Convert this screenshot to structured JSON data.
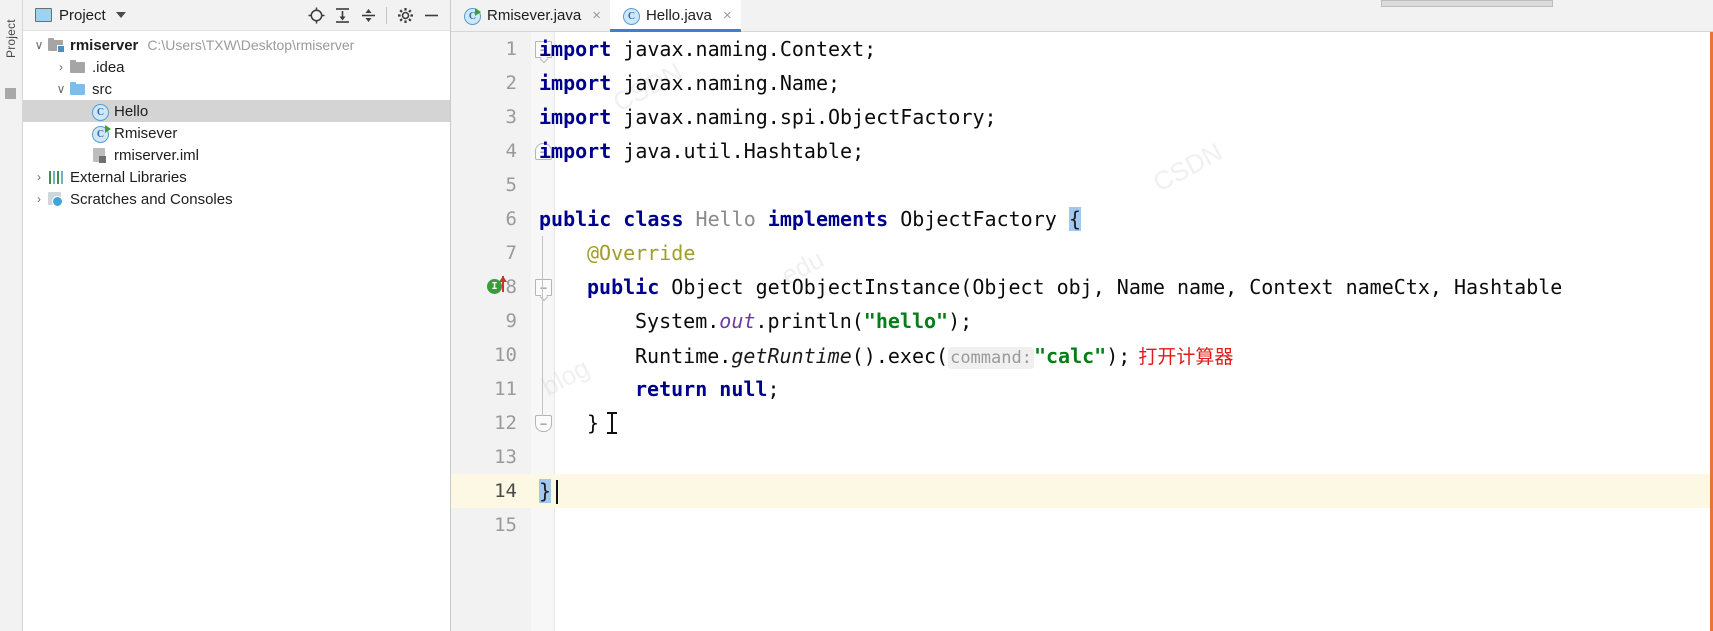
{
  "toolwindow": {
    "vertical_label": "Project"
  },
  "project_panel": {
    "header": {
      "title": "Project",
      "dropdown_icon": "chevron-down-icon",
      "actions": [
        {
          "name": "locate-icon",
          "glyph": "⊕"
        },
        {
          "name": "expand-all-icon",
          "glyph": "⤓"
        },
        {
          "name": "collapse-all-icon",
          "glyph": "⤒"
        },
        {
          "name": "settings-gear-icon",
          "glyph": "⚙"
        },
        {
          "name": "hide-icon",
          "glyph": "—"
        }
      ]
    },
    "tree": [
      {
        "label": "rmiserver",
        "path": "C:\\Users\\TXW\\Desktop\\rmiserver",
        "icon": "module-folder-icon",
        "arrow": "∨",
        "indent": 0,
        "bold": true,
        "selected": false
      },
      {
        "label": ".idea",
        "path": "",
        "icon": "folder-gray-icon",
        "arrow": "›",
        "indent": 1,
        "bold": false,
        "selected": false
      },
      {
        "label": "src",
        "path": "",
        "icon": "folder-blue-icon",
        "arrow": "∨",
        "indent": 1,
        "bold": false,
        "selected": false
      },
      {
        "label": "Hello",
        "path": "",
        "icon": "java-class-icon",
        "arrow": "",
        "indent": 2,
        "bold": false,
        "selected": true
      },
      {
        "label": "Rmisever",
        "path": "",
        "icon": "java-runnable-class-icon",
        "arrow": "",
        "indent": 2,
        "bold": false,
        "selected": false
      },
      {
        "label": "rmiserver.iml",
        "path": "",
        "icon": "iml-file-icon",
        "arrow": "",
        "indent": 1,
        "bold": false,
        "selected": false
      },
      {
        "label": "External Libraries",
        "path": "",
        "icon": "libraries-icon",
        "arrow": "›",
        "indent": 0,
        "bold": false,
        "selected": false
      },
      {
        "label": "Scratches and Consoles",
        "path": "",
        "icon": "scratches-icon",
        "arrow": "›",
        "indent": 0,
        "bold": false,
        "selected": false
      }
    ]
  },
  "editor": {
    "tabs": [
      {
        "label": "Rmisever.java",
        "icon": "java-runnable-class-icon",
        "close": "×",
        "active": false
      },
      {
        "label": "Hello.java",
        "icon": "java-class-icon",
        "close": "×",
        "active": true
      }
    ],
    "line_numbers": [
      "1",
      "2",
      "3",
      "4",
      "5",
      "6",
      "7",
      "8",
      "9",
      "10",
      "11",
      "12",
      "13",
      "14",
      "15"
    ],
    "current_line": "14",
    "gutter_marker_line": "8",
    "gutter_marker_glyph": "I",
    "code": {
      "l1_kw": "import",
      "l1_rest": " javax.naming.Context;",
      "l2_kw": "import",
      "l2_rest": " javax.naming.Name;",
      "l3_kw": "import",
      "l3_rest": " javax.naming.spi.ObjectFactory;",
      "l4_kw": "import",
      "l4_rest": " java.util.Hashtable;",
      "l6_kw1": "public class",
      "l6_cls": " Hello ",
      "l6_kw2": "implements",
      "l6_iface": " ObjectFactory ",
      "l6_brace": "{",
      "l7_anno": "@Override",
      "l8_kw": "public",
      "l8_sig": " Object getObjectInstance(Object obj, Name name, Context nameCtx, Hashtable",
      "l9_a": "System.",
      "l9_field": "out",
      "l9_b": ".println(",
      "l9_str": "\"hello\"",
      "l9_c": ");",
      "l10_a": "Runtime.",
      "l10_meth": "getRuntime",
      "l10_b": "().exec(",
      "l10_hint": "command:",
      "l10_str": "\"calc\"",
      "l10_c": ");",
      "l10_comment": "打开计算器",
      "l11_kw1": "return",
      "l11_kw2": " null",
      "l11_semi": ";",
      "l12_brace": "}",
      "l14_brace": "}"
    }
  },
  "colors": {
    "keyword": "#00008f",
    "string": "#067d17",
    "annotation": "#9e9e28",
    "comment_red": "#e01b1b",
    "field_purple": "#6a3ca0",
    "selection_gray": "#d4d4d4",
    "current_line": "#fdf8e3",
    "brace_highlight": "#a3c8f0",
    "tab_underline": "#3f7fd0"
  }
}
